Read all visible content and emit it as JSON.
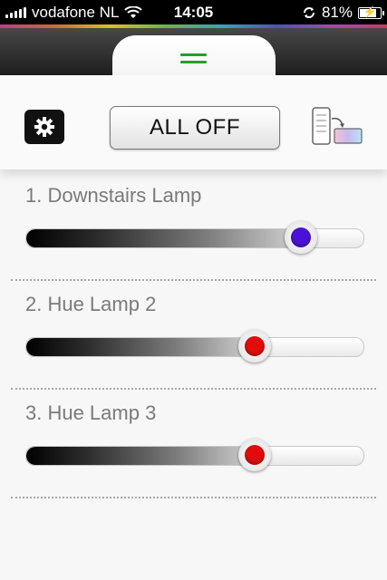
{
  "status_bar": {
    "carrier": "vodafone NL",
    "time": "14:05",
    "battery": "81%",
    "battery_level": 0.81
  },
  "header": {
    "handle_icon": "menu-handle-icon",
    "rainbow_colors": [
      "#d43b8f",
      "#e7702b",
      "#f1d423",
      "#6ccc3c",
      "#2fb6d2",
      "#4b56d0",
      "#b745c7",
      "#e13a63"
    ]
  },
  "controls": {
    "settings_icon": "gear-icon",
    "all_off_label": "ALL OFF",
    "link_icon": "bridge-link-icon"
  },
  "lamps": [
    {
      "name": "1. Downstairs Lamp",
      "brightness": 0.85,
      "color": "#4a12d6"
    },
    {
      "name": "2. Hue Lamp 2",
      "brightness": 0.7,
      "color": "#e10d0d"
    },
    {
      "name": "3. Hue Lamp 3",
      "brightness": 0.7,
      "color": "#e10d0d"
    }
  ]
}
